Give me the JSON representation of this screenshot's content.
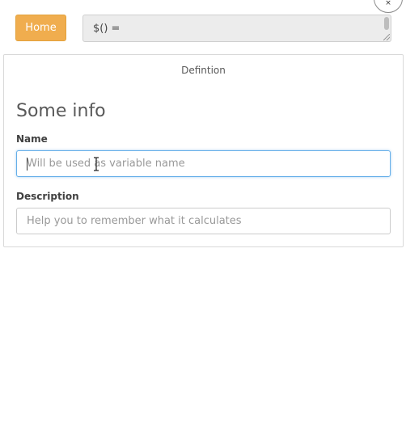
{
  "toolbar": {
    "home_label": "Home",
    "expression_value": "$() =",
    "close_symbol": "×"
  },
  "panel": {
    "title": "Defintion",
    "section_heading": "Some info",
    "fields": {
      "name": {
        "label": "Name",
        "placeholder": "Will be used as variable name",
        "value": ""
      },
      "description": {
        "label": "Description",
        "placeholder": "Help you to remember what it calculates",
        "value": ""
      }
    }
  },
  "colors": {
    "home_button": "#f0ad4e",
    "focus_border": "#66afe9"
  }
}
